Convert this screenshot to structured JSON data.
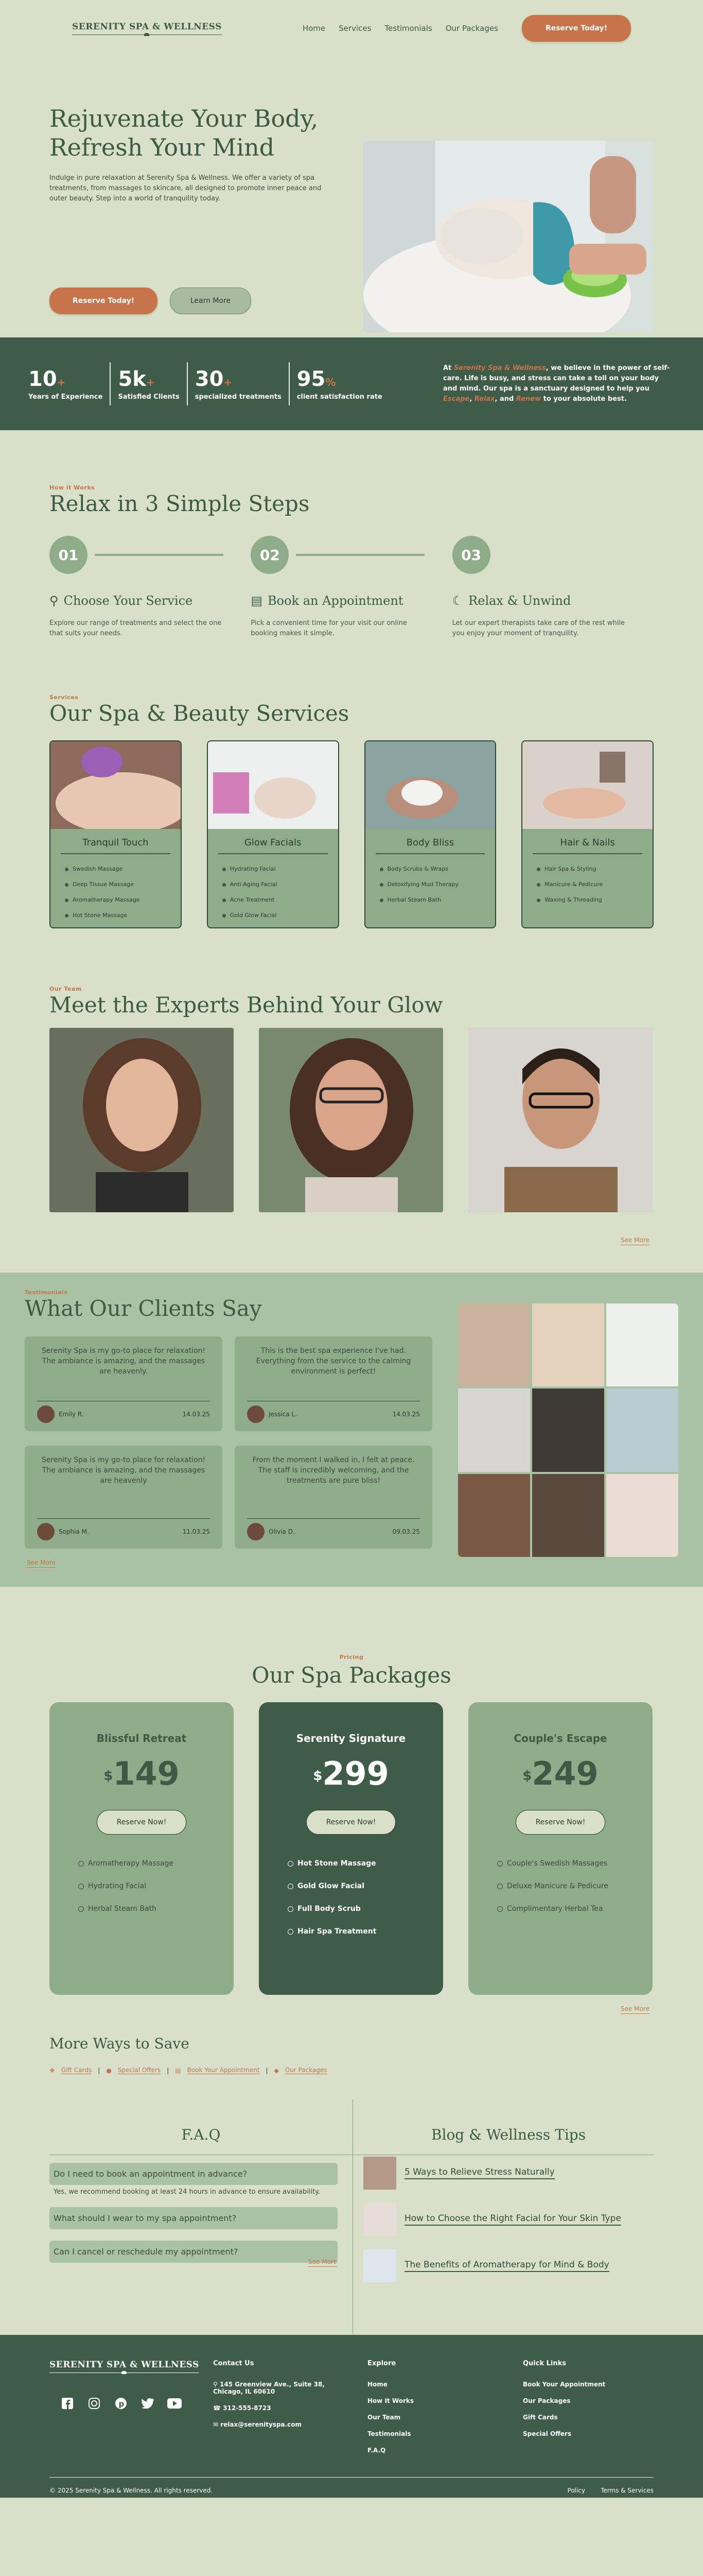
{
  "nav": {
    "logo": "SERENITY SPA & WELLNESS",
    "links": [
      "Home",
      "Services",
      "Testimonials",
      "Our Packages"
    ],
    "cta": "Reserve Today!"
  },
  "hero": {
    "title": "Rejuvenate Your Body, Refresh Your Mind",
    "text": "Indulge in pure relaxation at Serenity Spa & Wellness. We offer a variety of spa treatments, from massages to skincare, all designed to promote inner peace and outer beauty. Step into a world of tranquility today.",
    "btn_primary": "Reserve Today!",
    "btn_secondary": "Learn More"
  },
  "stats": {
    "items": [
      {
        "n": "10",
        "s": "+",
        "l": "Years of Experience"
      },
      {
        "n": "5k",
        "s": "+",
        "l": "Satisfied Clients"
      },
      {
        "n": "30",
        "s": "+",
        "l": "specialized treatments"
      },
      {
        "n": "95",
        "s": "%",
        "l": "client satisfaction rate"
      }
    ],
    "m1": "At ",
    "brand": "Serenity Spa & Wellness",
    "m2": ", we believe in the power of self-care. Life is busy, and stress can take a toll on your body and mind. Our spa is a sanctuary designed to help you ",
    "w1": "Escape",
    "m3": ", ",
    "w2": "Relax",
    "m4": ", and ",
    "w3": "Renew",
    "m5": " to your absolute best."
  },
  "steps": {
    "eyebrow": "How it Works",
    "title": "Relax in 3 Simple Steps",
    "items": [
      {
        "num": "01",
        "title": "Choose Your Service",
        "text": "Explore our range of treatments and select the one that suits your needs."
      },
      {
        "num": "02",
        "title": "Book an Appointment",
        "text": "Pick a convenient time for your visit our online booking makes it simple."
      },
      {
        "num": "03",
        "title": "Relax & Unwind",
        "text": "Let our expert therapists take care of the rest while you enjoy your moment of tranquility."
      }
    ]
  },
  "services": {
    "eyebrow": "Services",
    "title": "Our Spa & Beauty Services",
    "cards": [
      {
        "title": "Tranquil Touch",
        "items": [
          "Swedish Massage",
          "Deep Tissue Massage",
          "Aromatherapy Massage",
          "Hot Stone Massage"
        ]
      },
      {
        "title": "Glow Facials",
        "items": [
          "Hydrating Facial",
          "Anti-Aging Facial",
          "Acne Treatment",
          "Gold Glow Facial"
        ]
      },
      {
        "title": "Body Bliss",
        "items": [
          "Body Scrubs & Wraps",
          "Detoxifying Mud Therapy",
          "Herbal Steam Bath"
        ]
      },
      {
        "title": "Hair & Nails",
        "items": [
          "Hair Spa & Styling",
          "Manicure & Pedicure",
          "Waxing & Threading"
        ]
      }
    ]
  },
  "team": {
    "eyebrow": "Our Team",
    "title": "Meet the Experts Behind Your Glow",
    "more": "See More"
  },
  "testimonials": {
    "eyebrow": "Testimonials",
    "title": "What Our Clients Say",
    "more": "See More",
    "items": [
      {
        "text": "Serenity Spa is my go-to place for relaxation! The ambiance is amazing, and the massages are heavenly.",
        "name": "Emily R.",
        "date": "14.03.25"
      },
      {
        "text": "This is the best spa experience I've had. Everything from the service to the calming environment is perfect!",
        "name": "Jessica L.",
        "date": "14.03.25"
      },
      {
        "text": "Serenity Spa is my go-to place for relaxation! The ambiance is amazing, and the massages are heavenly",
        "name": "Sophia M.",
        "date": "11.03.25"
      },
      {
        "text": "From the moment I walked in, I felt at peace. The staff is incredibly welcoming, and the treatments are pure bliss!",
        "name": "Olivia D.",
        "date": "09.03.25"
      }
    ]
  },
  "pricing": {
    "eyebrow": "Pricing",
    "title": "Our Spa Packages",
    "more": "See More",
    "plans": [
      {
        "name": "Blissful Retreat",
        "cur": "$",
        "price": "149",
        "btn": "Reserve Now!",
        "items": [
          "Aromatherapy Massage",
          "Hydrating Facial",
          "Herbal Steam Bath"
        ]
      },
      {
        "name": "Serenity Signature",
        "cur": "$",
        "price": "299",
        "btn": "Reserve Now!",
        "items": [
          "Hot Stone Massage",
          "Gold Glow Facial",
          "Full Body Scrub",
          "Hair Spa Treatment"
        ]
      },
      {
        "name": "Couple's Escape",
        "cur": "$",
        "price": "249",
        "btn": "Reserve Now!",
        "items": [
          "Couple's Swedish Massages",
          "Deluxe Manicure & Pedicure",
          "Complimentary Herbal Tea"
        ]
      }
    ]
  },
  "ways": {
    "title": "More Ways to Save",
    "links": [
      "Gift Cards",
      "Special Offers",
      "Book Your Appointment",
      "Our Packages"
    ]
  },
  "faq": {
    "title": "F.A.Q",
    "items": [
      {
        "q": "Do I need to book an appointment in advance?",
        "a": "Yes, we recommend booking at least 24 hours in advance to ensure availability."
      },
      {
        "q": "What should I wear to my spa appointment?",
        "a": ""
      },
      {
        "q": "Can I cancel or reschedule my appointment?",
        "a": ""
      }
    ],
    "more": "See More"
  },
  "blog": {
    "title": "Blog & Wellness Tips",
    "posts": [
      "5 Ways to Relieve Stress Naturally",
      "How to Choose the Right Facial for Your Skin Type",
      "The Benefits of Aromatherapy for Mind & Body"
    ]
  },
  "footer": {
    "logo": "SERENITY SPA & WELLNESS",
    "contact": {
      "title": "Contact Us",
      "address": "145 Greenview Ave., Suite 38, Chicago, IL 60610",
      "phone": "312-555-8723",
      "email": "relax@serenityspa.com"
    },
    "explore": {
      "title": "Explore",
      "links": [
        "Home",
        "How It Works",
        "Our Team",
        "Testimonials",
        "F.A.Q"
      ]
    },
    "quick": {
      "title": "Quick Links",
      "links": [
        "Book Your Appointment",
        "Our Packages",
        "Gift Cards",
        "Special Offers"
      ]
    },
    "copyright": "© 2025 Serenity Spa & Wellness. All rights reserved.",
    "policy": "Policy",
    "terms": "Terms & Services"
  },
  "colors": {
    "bg": "#d9e0c9",
    "dark": "#3f5c48",
    "mid": "#8eac8a",
    "light": "#a9c2a3",
    "accent": "#c8744a"
  }
}
